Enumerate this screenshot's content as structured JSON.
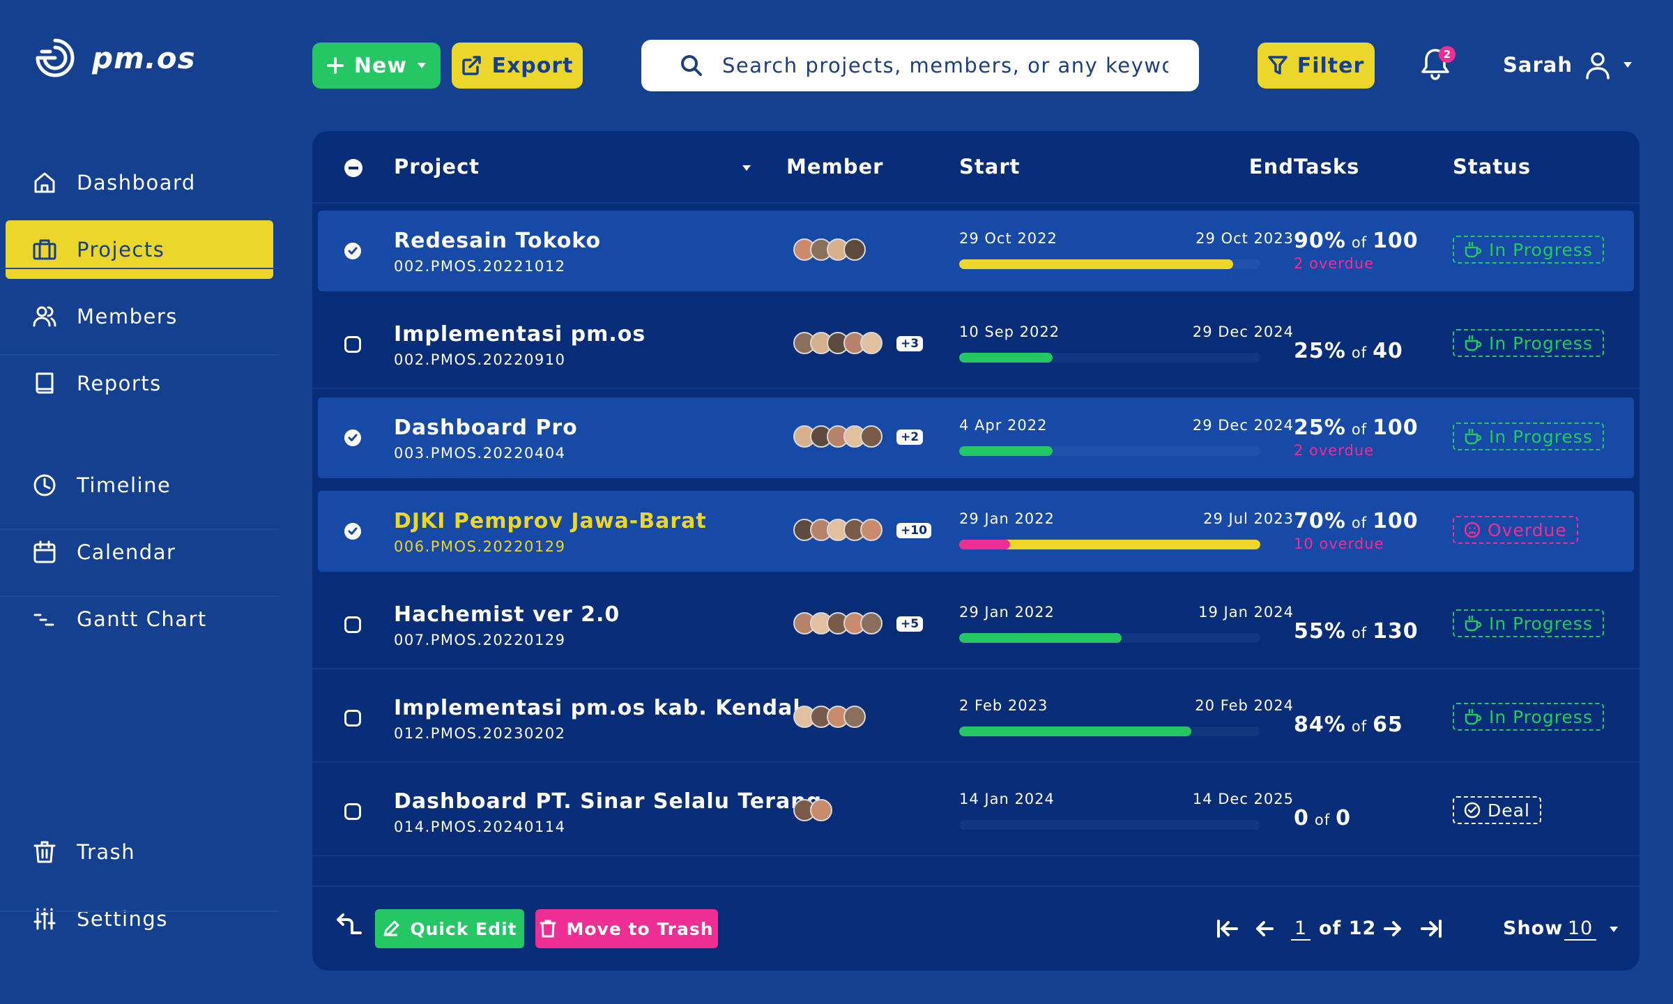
{
  "app": {
    "name": "pm.os"
  },
  "sidebar": {
    "items": [
      {
        "label": "Dashboard",
        "icon": "home-icon"
      },
      {
        "label": "Projects",
        "icon": "briefcase-icon"
      },
      {
        "label": "Members",
        "icon": "users-icon"
      },
      {
        "label": "Reports",
        "icon": "book-icon"
      },
      {
        "label": "Timeline",
        "icon": "clock-icon"
      },
      {
        "label": "Calendar",
        "icon": "calendar-icon"
      },
      {
        "label": "Gantt Chart",
        "icon": "gantt-icon"
      },
      {
        "label": "Trash",
        "icon": "trash-icon"
      },
      {
        "label": "Settings",
        "icon": "sliders-icon"
      }
    ],
    "active": "Projects"
  },
  "toolbar": {
    "new_label": "New",
    "export_label": "Export",
    "search_placeholder": "Search projects, members, or any keywords",
    "filter_label": "Filter",
    "notification_count": "2",
    "user_name": "Sarah"
  },
  "table": {
    "columns": {
      "project": "Project",
      "member": "Member",
      "start": "Start",
      "end": "End",
      "tasks": "Tasks",
      "status": "Status"
    },
    "of_label": "of",
    "rows": [
      {
        "name": "Redesain Tokoko",
        "code": "002.PMOS.20221012",
        "selected": true,
        "highlight": false,
        "avatar_count": 4,
        "extra_members": "",
        "start": "29 Oct 2022",
        "end": "29 Oct 2023",
        "progress": 0.91,
        "progress_color": "#ecd62a",
        "progress_overdue": 0,
        "pct": "90%",
        "total": "100",
        "overdue": "2 overdue",
        "status": "In Progress",
        "status_type": "progress"
      },
      {
        "name": "Implementasi pm.os",
        "code": "002.PMOS.20220910",
        "selected": false,
        "highlight": false,
        "avatar_count": 5,
        "extra_members": "+3",
        "start": "10 Sep 2022",
        "end": "29 Dec 2024",
        "progress": 0.31,
        "progress_color": "#25c764",
        "progress_overdue": 0,
        "pct": "25%",
        "total": "40",
        "overdue": "",
        "status": "In Progress",
        "status_type": "progress"
      },
      {
        "name": "Dashboard Pro",
        "code": "003.PMOS.20220404",
        "selected": true,
        "highlight": false,
        "avatar_count": 5,
        "extra_members": "+2",
        "start": "4 Apr 2022",
        "end": "29 Dec 2024",
        "progress": 0.31,
        "progress_color": "#25c764",
        "progress_overdue": 0,
        "pct": "25%",
        "total": "100",
        "overdue": "2 overdue",
        "status": "In Progress",
        "status_type": "progress"
      },
      {
        "name": "DJKI Pemprov Jawa-Barat",
        "code": "006.PMOS.20220129",
        "selected": true,
        "highlight": true,
        "avatar_count": 5,
        "extra_members": "+10",
        "start": "29 Jan 2022",
        "end": "29 Jul 2023",
        "progress": 1.0,
        "progress_color": "#ecd62a",
        "progress_overdue": 0.17,
        "pct": "70%",
        "total": "100",
        "overdue": "10 overdue",
        "status": "Overdue",
        "status_type": "overdue"
      },
      {
        "name": "Hachemist ver 2.0",
        "code": "007.PMOS.20220129",
        "selected": false,
        "highlight": false,
        "avatar_count": 5,
        "extra_members": "+5",
        "start": "29 Jan 2022",
        "end": "19 Jan 2024",
        "progress": 0.54,
        "progress_color": "#25c764",
        "progress_overdue": 0,
        "pct": "55%",
        "total": "130",
        "overdue": "",
        "status": "In Progress",
        "status_type": "progress"
      },
      {
        "name": "Implementasi pm.os kab. Kendal",
        "code": "012.PMOS.20230202",
        "selected": false,
        "highlight": false,
        "avatar_count": 4,
        "extra_members": "",
        "start": "2 Feb 2023",
        "end": "20 Feb 2024",
        "progress": 0.77,
        "progress_color": "#25c764",
        "progress_overdue": 0,
        "pct": "84%",
        "total": "65",
        "overdue": "",
        "status": "In Progress",
        "status_type": "progress"
      },
      {
        "name": "Dashboard PT. Sinar Selalu Terang",
        "code": "014.PMOS.20240114",
        "selected": false,
        "highlight": false,
        "avatar_count": 2,
        "extra_members": "",
        "start": "14 Jan 2024",
        "end": "14 Dec 2025",
        "progress": 0,
        "progress_color": "#25c764",
        "progress_overdue": 0,
        "pct": "0",
        "total": "0",
        "overdue": "",
        "status": "Deal",
        "status_type": "deal"
      }
    ]
  },
  "footer": {
    "quick_edit_label": "Quick Edit",
    "move_to_trash_label": "Move to Trash",
    "page": "1",
    "of_pages": "of 12",
    "show_label": "Show",
    "show_value": "10"
  },
  "colors": {
    "bg": "#153f8f",
    "panel": "#082d78",
    "yellow": "#ecd62a",
    "green": "#25c764",
    "pink": "#ef2e93"
  }
}
